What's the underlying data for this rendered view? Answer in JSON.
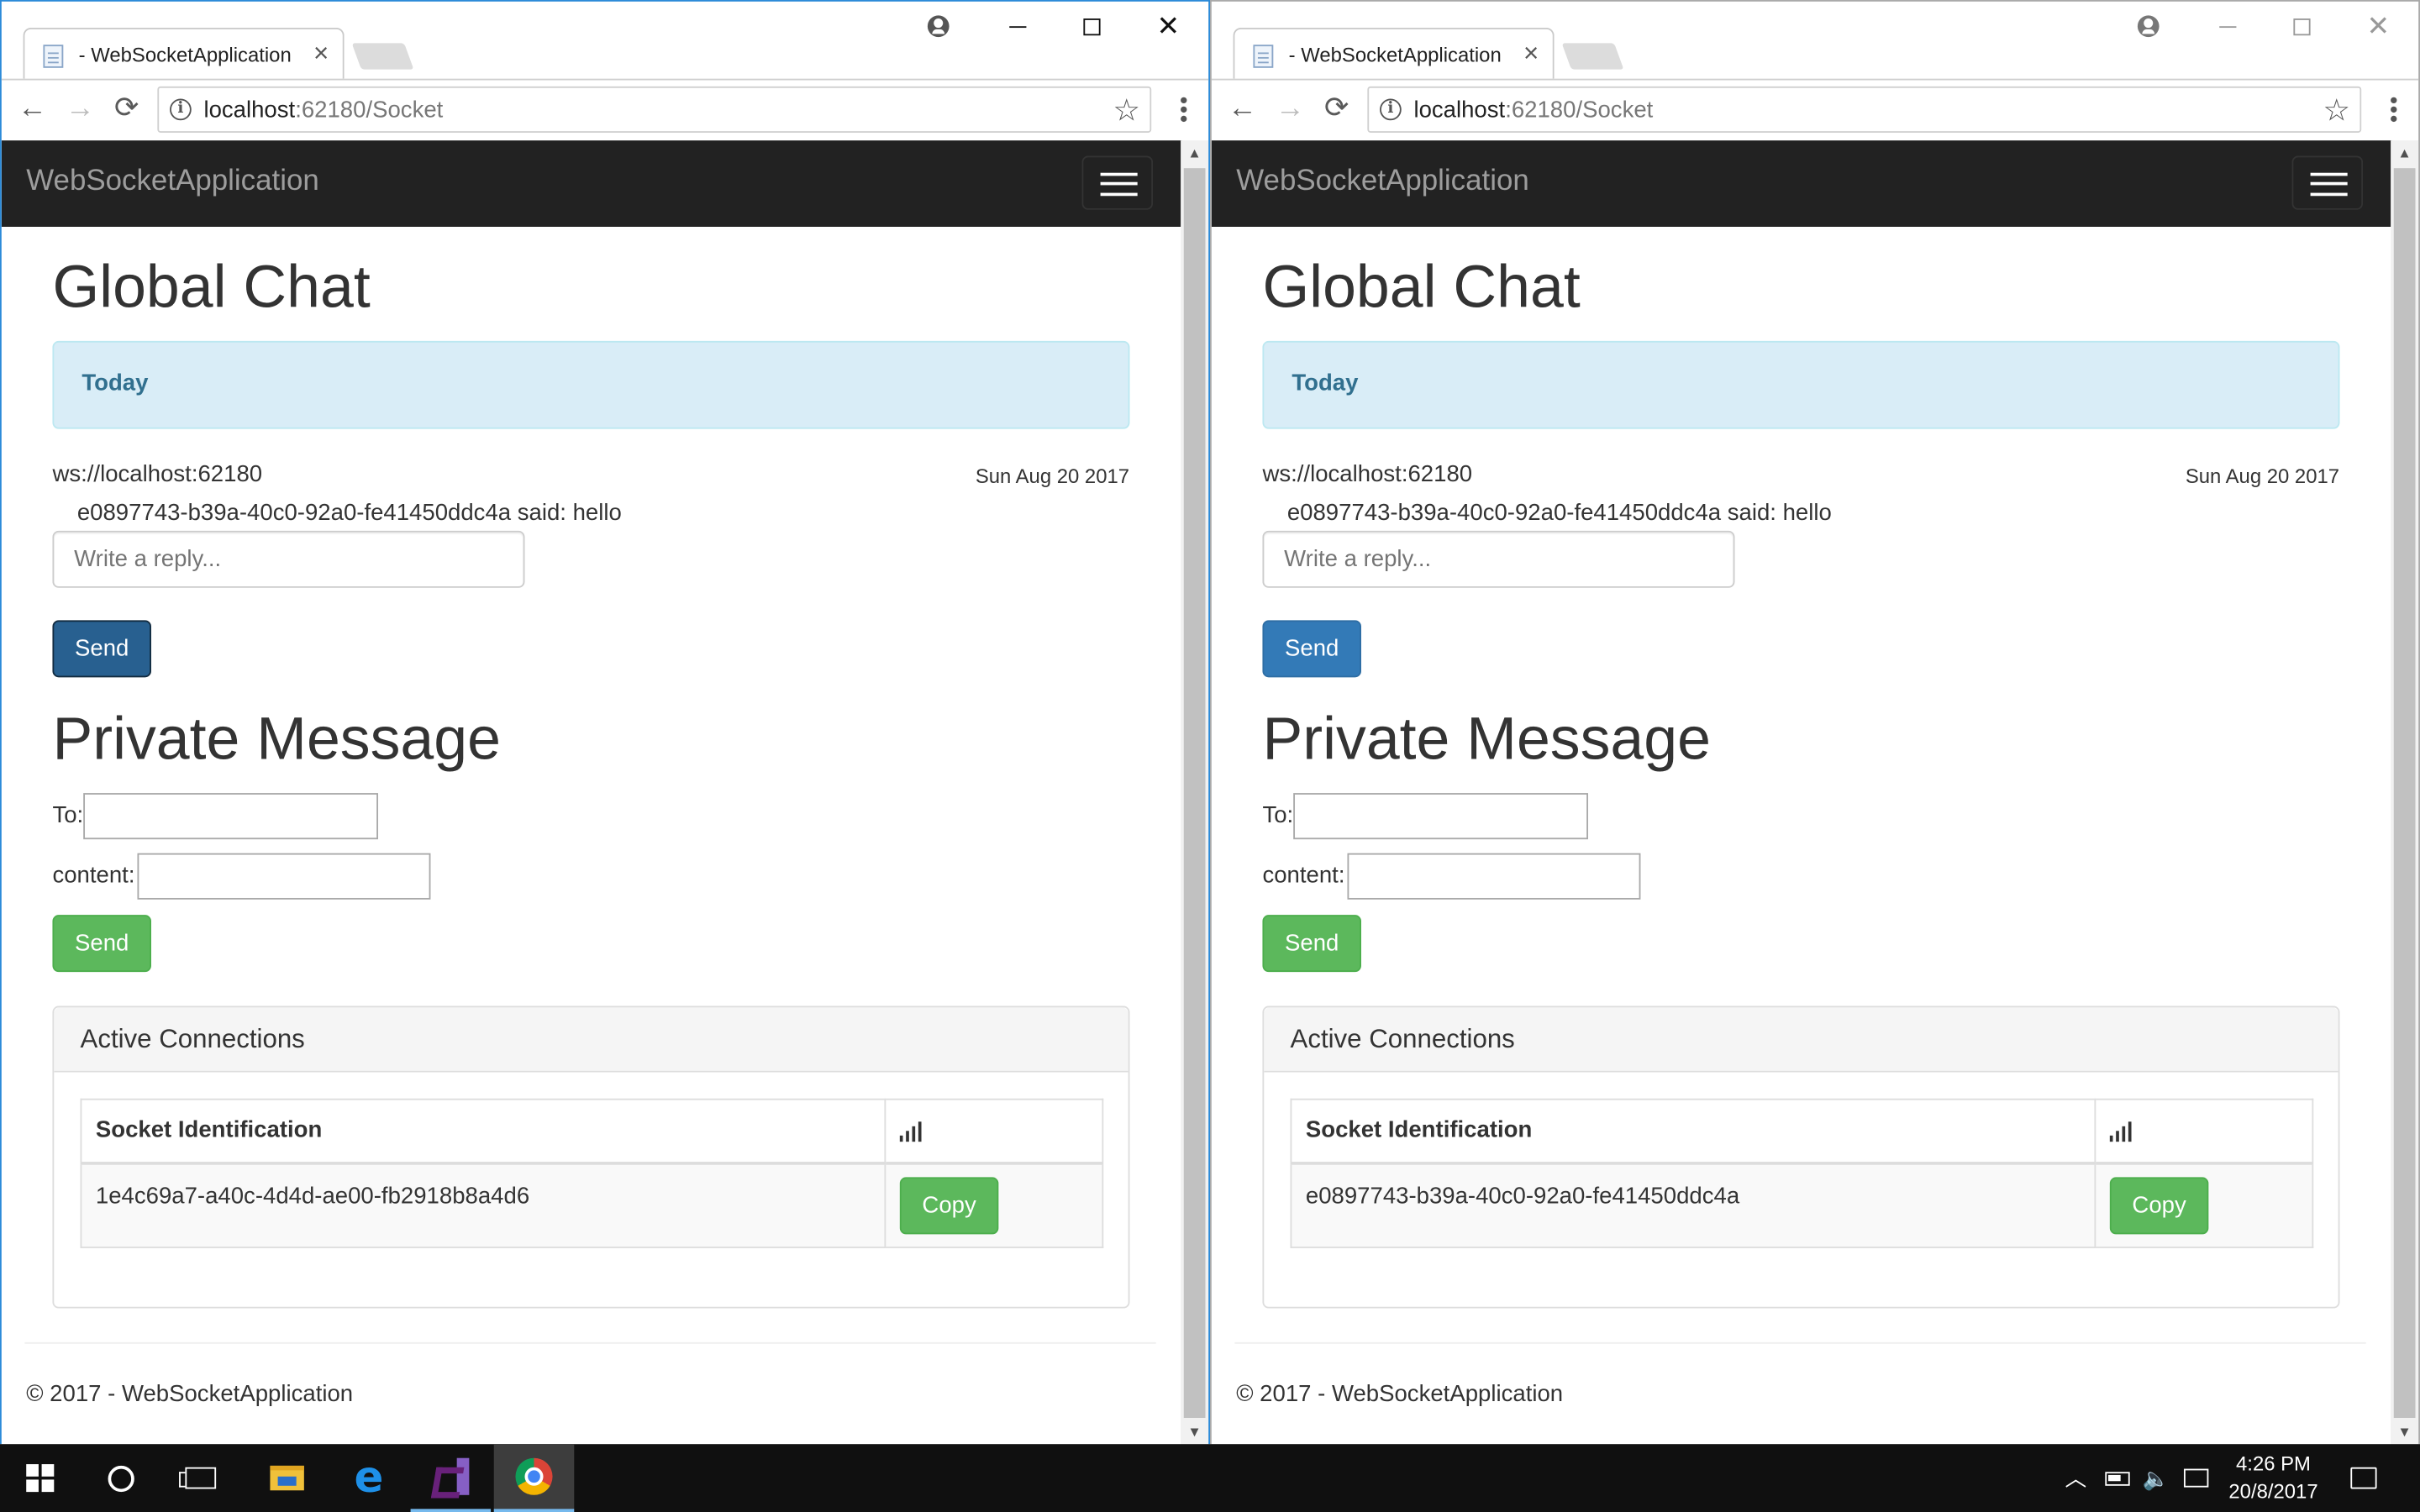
{
  "browser": {
    "tab_title": "- WebSocketApplication",
    "tab_close": "×",
    "url_host": "localhost",
    "url_path": ":62180/Socket",
    "back": "←",
    "forward": "→",
    "reload": "⟳",
    "star": "☆",
    "info": "i",
    "minimize": "",
    "close": "✕"
  },
  "app": {
    "brand": "WebSocketApplication",
    "global_chat_title": "Global Chat",
    "today_label": "Today",
    "server": "ws://localhost:62180",
    "date": "Sun Aug 20 2017",
    "message": "e0897743-b39a-40c0-92a0-fe41450ddc4a said: hello",
    "reply_placeholder": "Write a reply...",
    "send_label": "Send",
    "private_title": "Private Message",
    "to_label": "To:",
    "content_label": "content:",
    "pm_send_label": "Send",
    "connections_title": "Active Connections",
    "col_socket": "Socket Identification",
    "copy_label": "Copy",
    "footer": "© 2017 - WebSocketApplication"
  },
  "windows": {
    "left": {
      "socket_id": "1e4c69a7-a40c-4d4d-ae00-fb2918b8a4d6",
      "focused": true
    },
    "right": {
      "socket_id": "e0897743-b39a-40c0-92a0-fe41450ddc4a",
      "focused": false
    }
  },
  "taskbar": {
    "time": "4:26 PM",
    "date": "20/8/2017",
    "apps": [
      "start-icon",
      "cortana-icon",
      "task-view-icon",
      "file-explorer-icon",
      "edge-icon",
      "visual-studio-icon",
      "chrome-icon"
    ]
  },
  "colors": {
    "navbar": "#222222",
    "primary": "#337ab7",
    "success": "#5cb85c",
    "alert_info_bg": "#d9edf7",
    "focus_border": "#2b8ad8"
  }
}
